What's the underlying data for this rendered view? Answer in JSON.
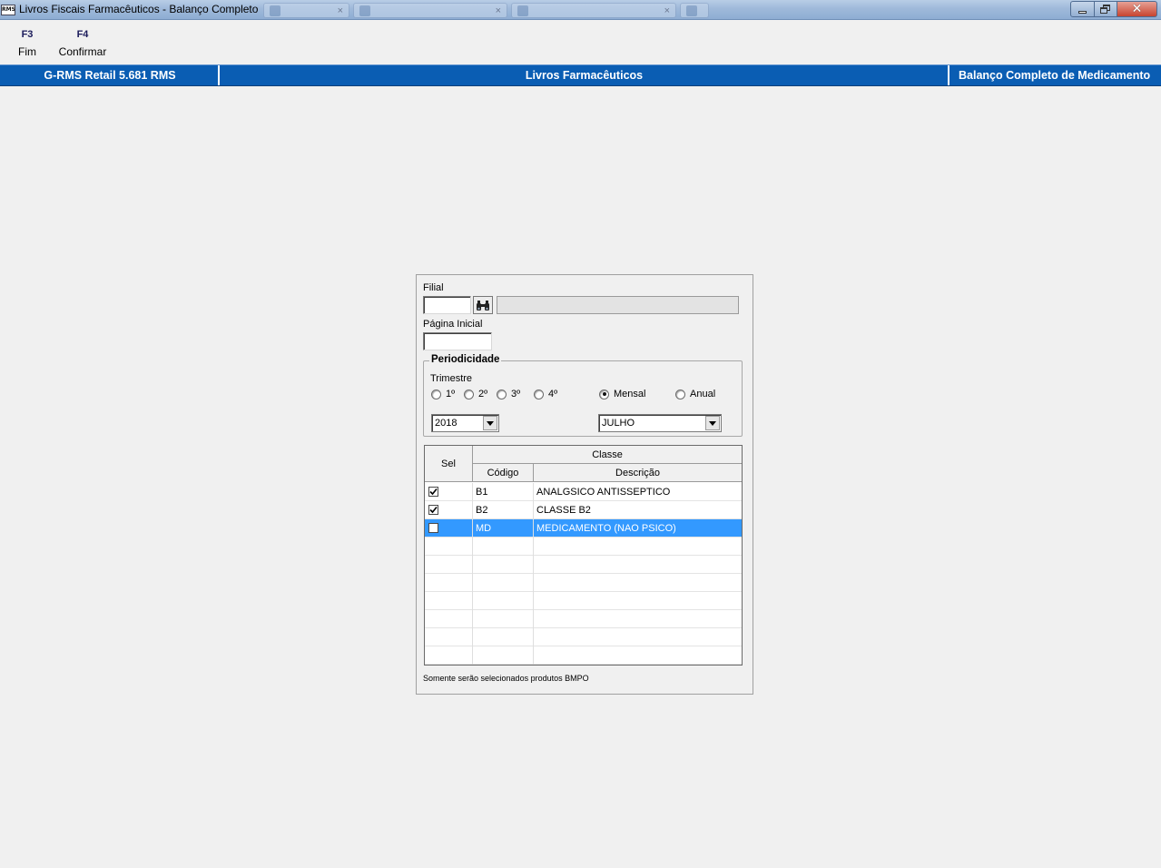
{
  "window": {
    "title": "Livros Fiscais Farmacêuticos - Balanço Completo",
    "app_icon_text": "RMS"
  },
  "function_keys": [
    {
      "key": "F3",
      "label": "Fim"
    },
    {
      "key": "F4",
      "label": "Confirmar"
    }
  ],
  "header_band": {
    "system": "G-RMS Retail 5.681 RMS",
    "module": "Livros Farmacêuticos",
    "screen": "Balanço Completo de Medicamento"
  },
  "form": {
    "filial_label": "Filial",
    "filial_value": "",
    "filial_name": "",
    "pagina_inicial_label": "Página Inicial",
    "pagina_inicial_value": "",
    "periodicidade_title": "Periodicidade",
    "trimestre_label": "Trimestre",
    "trimestre_options": [
      "1º",
      "2º",
      "3º",
      "4º"
    ],
    "trimestre_selected": null,
    "period_options": [
      "Mensal",
      "Anual"
    ],
    "period_selected": "Mensal",
    "year_value": "2018",
    "month_value": "JULHO"
  },
  "grid": {
    "header_sel": "Sel",
    "header_group": "Classe",
    "header_codigo": "Código",
    "header_descricao": "Descrição",
    "rows": [
      {
        "sel": true,
        "codigo": "B1",
        "descricao": "ANALGSICO ANTISSEPTICO",
        "highlighted": false
      },
      {
        "sel": true,
        "codigo": "B2",
        "descricao": "CLASSE B2",
        "highlighted": false
      },
      {
        "sel": false,
        "codigo": "MD",
        "descricao": "MEDICAMENTO (NAO PSICO)",
        "highlighted": true
      }
    ],
    "empty_rows": 7,
    "selection_color": "#3399ff"
  },
  "footnote": "Somente serão selecionados produtos BMPO",
  "colors": {
    "band_blue": "#0a5db3",
    "window_bg": "#f0f0f0"
  }
}
